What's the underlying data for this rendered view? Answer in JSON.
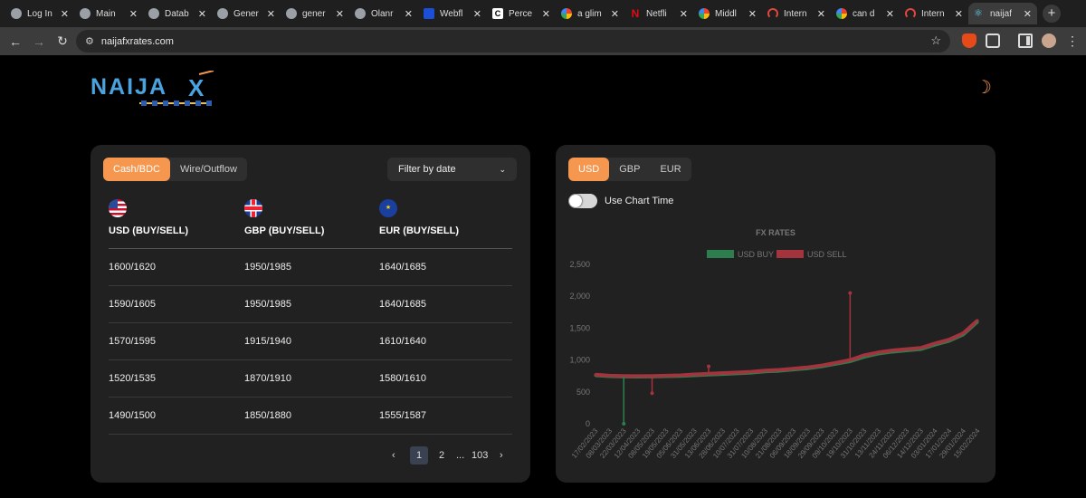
{
  "browser": {
    "tabs": [
      {
        "title": "Log In",
        "icon": "globe-icon",
        "fav": ""
      },
      {
        "title": "Main",
        "icon": "wordpress-icon",
        "fav": ""
      },
      {
        "title": "Datab",
        "icon": "globe-icon",
        "fav": ""
      },
      {
        "title": "Gener",
        "icon": "wordpress-icon",
        "fav": ""
      },
      {
        "title": "gener",
        "icon": "globe-icon",
        "fav": ""
      },
      {
        "title": "Olanr",
        "icon": "github-icon",
        "fav": ""
      },
      {
        "title": "Webfl",
        "icon": "webflow-icon",
        "fav": "blue"
      },
      {
        "title": "Perce",
        "icon": "c-icon",
        "fav": "blk"
      },
      {
        "title": "a glim",
        "icon": "google-icon",
        "fav": "goog"
      },
      {
        "title": "Netfli",
        "icon": "netflix-icon",
        "fav": "netflix"
      },
      {
        "title": "Middl",
        "icon": "google-icon",
        "fav": "goog"
      },
      {
        "title": "Intern",
        "icon": "speed-icon",
        "fav": "red"
      },
      {
        "title": "can d",
        "icon": "google-icon",
        "fav": "goog"
      },
      {
        "title": "Intern",
        "icon": "speed-icon",
        "fav": "red"
      }
    ],
    "active_tab": {
      "title": "naijaf",
      "icon": "react-icon"
    },
    "url": "naijafxrates.com"
  },
  "brand": {
    "logo_text": "NAIJA",
    "logo_mark": "X"
  },
  "rates_card": {
    "tabs": [
      "Cash/BDC",
      "Wire/Outflow"
    ],
    "active_tab": "Cash/BDC",
    "filter_label": "Filter by date",
    "columns": [
      {
        "label": "USD (BUY/SELL)",
        "flag": "us-flag-icon"
      },
      {
        "label": "GBP (BUY/SELL)",
        "flag": "uk-flag-icon"
      },
      {
        "label": "EUR (BUY/SELL)",
        "flag": "eu-flag-icon"
      }
    ],
    "rows": [
      [
        "1600/1620",
        "1950/1985",
        "1640/1685"
      ],
      [
        "1590/1605",
        "1950/1985",
        "1640/1685"
      ],
      [
        "1570/1595",
        "1915/1940",
        "1610/1640"
      ],
      [
        "1520/1535",
        "1870/1910",
        "1580/1610"
      ],
      [
        "1490/1500",
        "1850/1880",
        "1555/1587"
      ]
    ],
    "pagination": {
      "current": "1",
      "next": "2",
      "ellipsis": "...",
      "last": "103"
    }
  },
  "chart_card": {
    "currency_tabs": [
      "USD",
      "GBP",
      "EUR"
    ],
    "active_currency": "USD",
    "toggle_label": "Use Chart Time",
    "toggle_on": false
  },
  "colors": {
    "accent": "#f5974e",
    "buy": "#2e7d4f",
    "sell": "#a3333d",
    "card": "#212121"
  },
  "chart_data": {
    "type": "line",
    "title": "FX RATES",
    "legend": [
      "USD BUY",
      "USD SELL"
    ],
    "legend_position": "top",
    "ylim": [
      0,
      2500
    ],
    "yticks": [
      "0",
      "500",
      "1,000",
      "1,500",
      "2,000",
      "2,500"
    ],
    "x": [
      "17/02/2023",
      "08/03/2023",
      "22/03/2023",
      "12/04/2023",
      "08/05/2023",
      "19/05/2023",
      "05/06/2023",
      "31/05/2023",
      "13/06/2023",
      "28/06/2023",
      "10/07/2023",
      "31/07/2023",
      "10/08/2023",
      "21/08/2023",
      "06/09/2023",
      "18/09/2023",
      "29/09/2023",
      "09/10/2023",
      "19/10/2023",
      "31/10/2023",
      "13/11/2023",
      "24/11/2023",
      "06/12/2023",
      "14/12/2023",
      "03/01/2024",
      "17/01/2024",
      "29/01/2024",
      "15/02/2024"
    ],
    "series": [
      {
        "name": "USD BUY",
        "color": "#2e7d4f",
        "values": [
          760,
          745,
          740,
          738,
          740,
          745,
          750,
          760,
          770,
          780,
          790,
          800,
          820,
          830,
          850,
          870,
          900,
          940,
          980,
          1050,
          1100,
          1130,
          1150,
          1170,
          1240,
          1300,
          1400,
          1600
        ]
      },
      {
        "name": "USD SELL",
        "color": "#a3333d",
        "values": [
          770,
          755,
          750,
          748,
          750,
          755,
          760,
          775,
          785,
          795,
          805,
          815,
          835,
          845,
          865,
          885,
          915,
          955,
          1000,
          1075,
          1120,
          1150,
          1170,
          1190,
          1260,
          1320,
          1420,
          1620
        ]
      }
    ],
    "annotations": [
      {
        "series": "USD BUY",
        "x": "22/03/2023",
        "value": 0
      },
      {
        "series": "USD SELL",
        "x": "08/05/2023",
        "value": 480
      },
      {
        "series": "USD SELL",
        "x": "13/06/2023",
        "value": 900
      },
      {
        "series": "USD SELL",
        "x": "19/10/2023",
        "value": 2050
      }
    ]
  }
}
